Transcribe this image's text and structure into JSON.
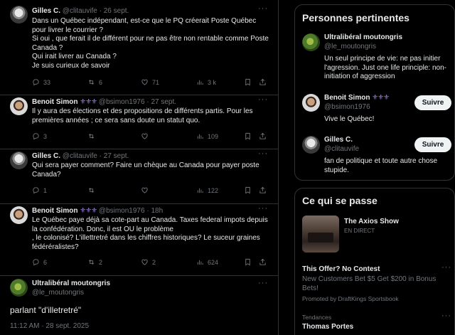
{
  "tweets": [
    {
      "name": "Gilles C.",
      "handle": "@clitauvife",
      "date": "26 sept.",
      "badges": "",
      "lines": [
        "Dans un Québec indépendant,  est-ce que le PQ créerait Poste Québec",
        "pour livrer le courrier ?",
        "Si oui , que ferait il de différent pour ne  pas être non rentable comme Poste",
        "Canada ?",
        "Qui irait livrer au Canada ?",
        "Je suis curieux de savoir"
      ],
      "replies": "33",
      "reposts": "6",
      "likes": "71",
      "views": "3 k"
    },
    {
      "name": "Benoit Simon",
      "handle": "@bsimon1976",
      "date": "27 sept.",
      "badges": "⚜⚜⚜",
      "lines": [
        "Il y aura des élections et des propositions de différents partis. Pour les",
        "premières années ; ce sera sans doute un statut quo."
      ],
      "replies": "3",
      "reposts": "",
      "likes": "",
      "views": "109"
    },
    {
      "name": "Gilles C.",
      "handle": "@clitauvife",
      "date": "27 sept.",
      "badges": "",
      "lines": [
        "Qui sera payer comment? Faire un chèque au Canada pour payer poste",
        "Canada?"
      ],
      "replies": "1",
      "reposts": "",
      "likes": "",
      "views": "122"
    },
    {
      "name": "Benoit Simon",
      "handle": "@bsimon1976",
      "date": "18h",
      "badges": "⚜⚜⚜",
      "lines": [
        "Le Québec paye déjà sa cote-part au Canada. Taxes federal impots depuis",
        "la confédération. Donc, il est OU le problème",
        ", le colonisé? L'illettretré dans les chiffres historiques? Le suceur graines",
        "fédéréralistes?"
      ],
      "replies": "6",
      "reposts": "2",
      "likes": "2",
      "views": "624"
    }
  ],
  "focus": {
    "name": "Ultralibéral moutongris",
    "handle": "@le_moutongris",
    "text": "parlant \"d'illetretré\"",
    "timestamp": "11:12 AM · 28 sept. 2025"
  },
  "relevant": {
    "title": "Personnes pertinentes",
    "people": [
      {
        "name": "Ultralibéral moutongris",
        "handle": "@le_moutongris",
        "badges": "",
        "bio": "Un seul principe de vie: ne pas initier l'agression. Just one life principle: non-initiation of aggression",
        "follow": ""
      },
      {
        "name": "Benoit Simon",
        "handle": "@bsimon1976",
        "badges": "⚜⚜⚜",
        "bio": "Vive le Québec!",
        "follow": "Suivre"
      },
      {
        "name": "Gilles C.",
        "handle": "@clitauvife",
        "badges": "",
        "bio": "fan de politique et toute autre chose stupide.",
        "follow": "Suivre"
      }
    ]
  },
  "happening": {
    "title": "Ce qui se passe",
    "live": {
      "title": "The Axios Show",
      "status": "EN DIRECT"
    },
    "promo": {
      "title": "This Offer? No Contest",
      "text": "New Customers Bet $5 Get $200 in Bonus Bets!",
      "by": "Promoted by DraftKings Sportsbook"
    },
    "trend": {
      "category": "Tendances",
      "name": "Thomas Portes"
    }
  },
  "icons": {
    "reply": "reply-icon",
    "repost": "repost-icon",
    "like": "heart-icon",
    "views": "views-icon",
    "bookmark": "bookmark-icon",
    "share": "share-icon",
    "more": "more-icon"
  },
  "colors": {
    "background": "#000000",
    "text": "#e7e9ea",
    "muted": "#71767b",
    "border": "#2f3336",
    "button": "#eff3f4",
    "badge": "#9b7fd6"
  }
}
